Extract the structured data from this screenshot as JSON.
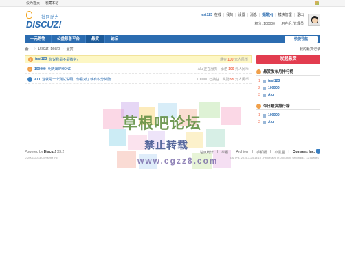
{
  "topbar": {
    "links": [
      "设为首页",
      "收藏本站"
    ]
  },
  "header": {
    "tagline": "社区动力",
    "wordmark": "DISCUZ!",
    "user": {
      "name": "test123",
      "status": "在线",
      "menu": [
        "我的",
        "设置",
        "消息",
        "提醒(4)",
        "模块管理",
        "退出"
      ],
      "credits": "积分: 100000",
      "group": "用户组: 管理员"
    }
  },
  "nav": {
    "items": [
      "一元购物",
      "公益慈善平台",
      "悬赏",
      "论坛"
    ],
    "active_index": 2,
    "quick_nav": "快捷导航"
  },
  "breadcrumb": {
    "items": [
      "Discuz! Board",
      "悬赏"
    ],
    "right": "我的悬赏记录"
  },
  "requests": [
    {
      "user": "test123",
      "text": "你说我是不是猪学?",
      "meta_prefix": "悬金",
      "price": "100",
      "meta_suffix": "元人民币",
      "highlight": true,
      "icon": "info-icon"
    },
    {
      "user": "100000",
      "text": "明天出IPHONE",
      "meta_prefix": "Alu 正在服务 · 承诺",
      "price": "100",
      "meta_suffix": "元人民币",
      "highlight": false,
      "icon": "user-icon"
    },
    {
      "user": "Alu",
      "text": "这就是一个测试说明，你看对了就有积分奖励!",
      "meta_prefix": "100000 已接任 · 奖励",
      "price": "95",
      "meta_suffix": "元人民币",
      "highlight": false,
      "icon": "info-icon"
    }
  ],
  "sidebar": {
    "post_button": "发起悬赏",
    "panel1": {
      "title": "悬赏发布月排行榜",
      "items": [
        {
          "rank": "1",
          "name": "test123"
        },
        {
          "rank": "2",
          "name": "100000"
        },
        {
          "rank": "3",
          "name": "Alu"
        }
      ]
    },
    "panel2": {
      "title": "今日悬赏排行榜",
      "items": [
        {
          "rank": "1",
          "name": "100000"
        },
        {
          "rank": "2",
          "name": "Alu"
        }
      ]
    }
  },
  "footer": {
    "powered_prefix": "Powered by",
    "powered_name": "Discuz!",
    "version": "X3.2",
    "copyright": "© 2001-2013 Comsenz Inc.",
    "links": [
      "站点统计",
      "举报",
      "Archiver",
      "手机版",
      "小黑屋"
    ],
    "company": "Comsenz Inc.",
    "gmt": "GMT+8, 2015-3-24 18:10 , Processed in 0.053895 second(s), 12 queries ."
  },
  "watermark": {
    "line1": "草根吧论坛",
    "line2": "禁止转载",
    "line3": "www.cgzz8.com"
  },
  "colors": {
    "brand_blue": "#2b6cb0",
    "post_red": "#e23c4f",
    "price_orange": "#f26c4f",
    "highlight_yellow": "#fdf7c4"
  }
}
